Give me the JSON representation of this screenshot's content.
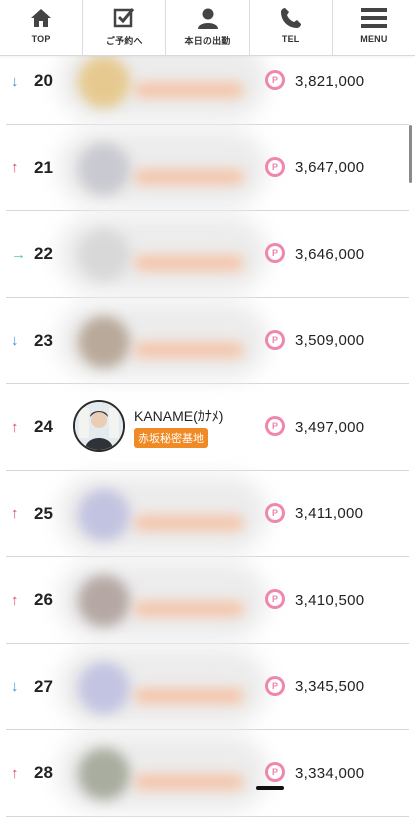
{
  "nav": {
    "items": [
      {
        "label": "TOP",
        "icon": "home-icon"
      },
      {
        "label": "ご予約へ",
        "icon": "reservation-icon"
      },
      {
        "label": "本日の出勤",
        "icon": "person-icon"
      },
      {
        "label": "TEL",
        "icon": "phone-icon"
      },
      {
        "label": "MENU",
        "icon": "menu-icon"
      }
    ]
  },
  "ranking": [
    {
      "rank": "20",
      "trend": "down",
      "trend_symbol": "↓",
      "points": "3,821,000",
      "blurred": true,
      "avatar_color": "#e6c98f"
    },
    {
      "rank": "21",
      "trend": "up",
      "trend_symbol": "↑",
      "points": "3,647,000",
      "blurred": true,
      "avatar_color": "#c9c9d1"
    },
    {
      "rank": "22",
      "trend": "flat",
      "trend_symbol": "→",
      "points": "3,646,000",
      "blurred": true,
      "avatar_color": "#d8d8d8"
    },
    {
      "rank": "23",
      "trend": "down",
      "trend_symbol": "↓",
      "points": "3,509,000",
      "blurred": true,
      "avatar_color": "#b9a99a"
    },
    {
      "rank": "24",
      "trend": "up",
      "trend_symbol": "↑",
      "points": "3,497,000",
      "blurred": false,
      "name": "KANAME(ｶﾅﾒ)",
      "shop": "赤坂秘密基地",
      "avatar_color": "#dfe7ea"
    },
    {
      "rank": "25",
      "trend": "up",
      "trend_symbol": "↑",
      "points": "3,411,000",
      "blurred": true,
      "avatar_color": "#c2c3e0"
    },
    {
      "rank": "26",
      "trend": "up",
      "trend_symbol": "↑",
      "points": "3,410,500",
      "blurred": true,
      "avatar_color": "#b5a8a4"
    },
    {
      "rank": "27",
      "trend": "down",
      "trend_symbol": "↓",
      "points": "3,345,500",
      "blurred": true,
      "avatar_color": "#c3c4e2"
    },
    {
      "rank": "28",
      "trend": "up",
      "trend_symbol": "↑",
      "points": "3,334,000",
      "blurred": true,
      "avatar_color": "#a9ad9f"
    }
  ],
  "point_badge_label": "P",
  "colors": {
    "up": "#e0475d",
    "down": "#3f8fd6",
    "flat": "#4fc9a4",
    "point_badge": "#ef86ad",
    "shop_tag": "#f08a24"
  }
}
